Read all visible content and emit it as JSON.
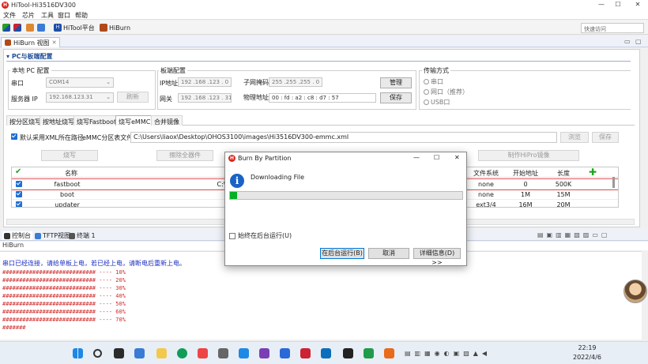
{
  "window": {
    "title": "HiTool-Hi3516DV300",
    "minimize": "—",
    "maximize": "☐",
    "close": "✕"
  },
  "menu": [
    "文件",
    "芯片",
    "工具",
    "窗口",
    "帮助"
  ],
  "toolbar": {
    "hitool_platform": "HiTool平台",
    "hiburn": "HiBurn",
    "quick_access_placeholder": "快速访问"
  },
  "view_tab": {
    "label": "HiBurn 视图"
  },
  "section_title": "PC与板端配置",
  "local_pc": {
    "group_label": "本地 PC 配置",
    "port_label": "串口",
    "port_value": "COM14",
    "server_ip_label": "服务器 IP",
    "server_ip_value": "192.168.123.31",
    "refresh": "刷新"
  },
  "board": {
    "group_label": "板端配置",
    "ip_label": "IP地址",
    "ip_value": "192 .168 .123 . 0",
    "mask_label": "子网掩码",
    "mask_value": "255 .255 .255 . 0",
    "gateway_label": "网关",
    "gateway_value": "192 .168 .123 . 31",
    "mac_label": "物理地址",
    "mac_value": "00 : fd : a2 : c8 : d7 : 57",
    "manage": "管理",
    "save": "保存"
  },
  "transfer": {
    "group_label": "传输方式",
    "options": [
      "串口",
      "网口（推荐）",
      "USB口"
    ]
  },
  "tabs": [
    "按分区烧写",
    "按地址烧写",
    "烧写Fastboot",
    "烧写eMMC",
    "合并镜像"
  ],
  "emmc": {
    "use_default_label": "默认采用XML所在路径",
    "table_file_label": "eMMC分区表文件",
    "path_value": "C:\\Users\\liaox\\Desktop\\OHOS3100\\images\\Hi3516DV300-emmc.xml",
    "browse": "浏览",
    "save": "保存",
    "burn": "烧写",
    "erase_all": "擦除全器件",
    "make_hipro": "制作HiPro镜像"
  },
  "table": {
    "headers": {
      "name": "名称",
      "fs": "文件系统",
      "start": "开始地址",
      "length": "长度"
    },
    "rows": [
      {
        "name": "fastboot",
        "file": "C:\\",
        "fs": "none",
        "start": "0",
        "length": "500K"
      },
      {
        "name": "boot",
        "file": "",
        "fs": "none",
        "start": "1M",
        "length": "15M"
      },
      {
        "name": "updater",
        "file": "",
        "fs": "ext3/4",
        "start": "16M",
        "length": "20M"
      }
    ]
  },
  "bottom_tabs": [
    "控制台",
    "TFTP视图",
    "终端 1"
  ],
  "console": {
    "title": "HiBurn",
    "message": "串口已经连接，请给单板上电，若已经上电，请断电后重新上电。",
    "progress_lines": [
      "############################ ---- 10%",
      "############################ ---- 20%",
      "############################ ---- 30%",
      "############################ ---- 40%",
      "############################ ---- 50%",
      "############################ ---- 60%",
      "############################ ---- 70%",
      "#######"
    ]
  },
  "dialog": {
    "title": "Burn By Partition",
    "message": "Downloading File",
    "progress": 0.03,
    "run_in_background_label": "始终在后台运行(U)",
    "background_btn": "在后台运行(B)",
    "cancel_btn": "取消",
    "details_btn": "详细信息(D) >>"
  },
  "clock": {
    "time": "22:19",
    "date": "2022/4/6"
  }
}
